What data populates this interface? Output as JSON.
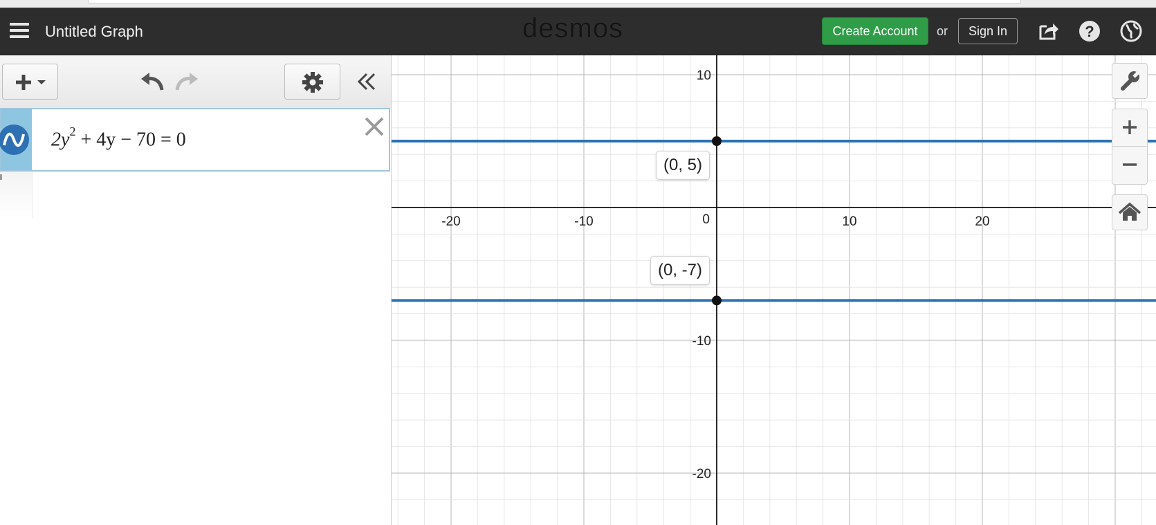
{
  "header": {
    "title": "Untitled Graph",
    "logo": "desmos",
    "create_account": "Create Account",
    "or": "or",
    "sign_in": "Sign In",
    "icons": [
      "menu-icon",
      "share-icon",
      "help-icon",
      "globe-icon"
    ]
  },
  "toolbar": {
    "icons": [
      "add-icon",
      "undo-icon",
      "redo-icon",
      "gear-icon",
      "collapse-icon"
    ]
  },
  "expression": {
    "parts": {
      "a": "2y",
      "exp": "2",
      "b": " + 4y − 70 = 0"
    },
    "color": "#2d70b3"
  },
  "graph": {
    "x_ticks": [
      "-20",
      "-10",
      "10",
      "20"
    ],
    "y_ticks": [
      "10",
      "-10",
      "-20"
    ],
    "origin_label": "0",
    "points": [
      {
        "label": "(0, 5)",
        "x": 0,
        "y": 5
      },
      {
        "label": "(0, -7)",
        "x": 0,
        "y": -7
      }
    ],
    "line_color": "#2d70b3",
    "lines_y": [
      5,
      -7
    ]
  },
  "controls": {
    "icons": [
      "wrench-icon",
      "zoom-in-icon",
      "zoom-out-icon",
      "home-icon"
    ]
  }
}
